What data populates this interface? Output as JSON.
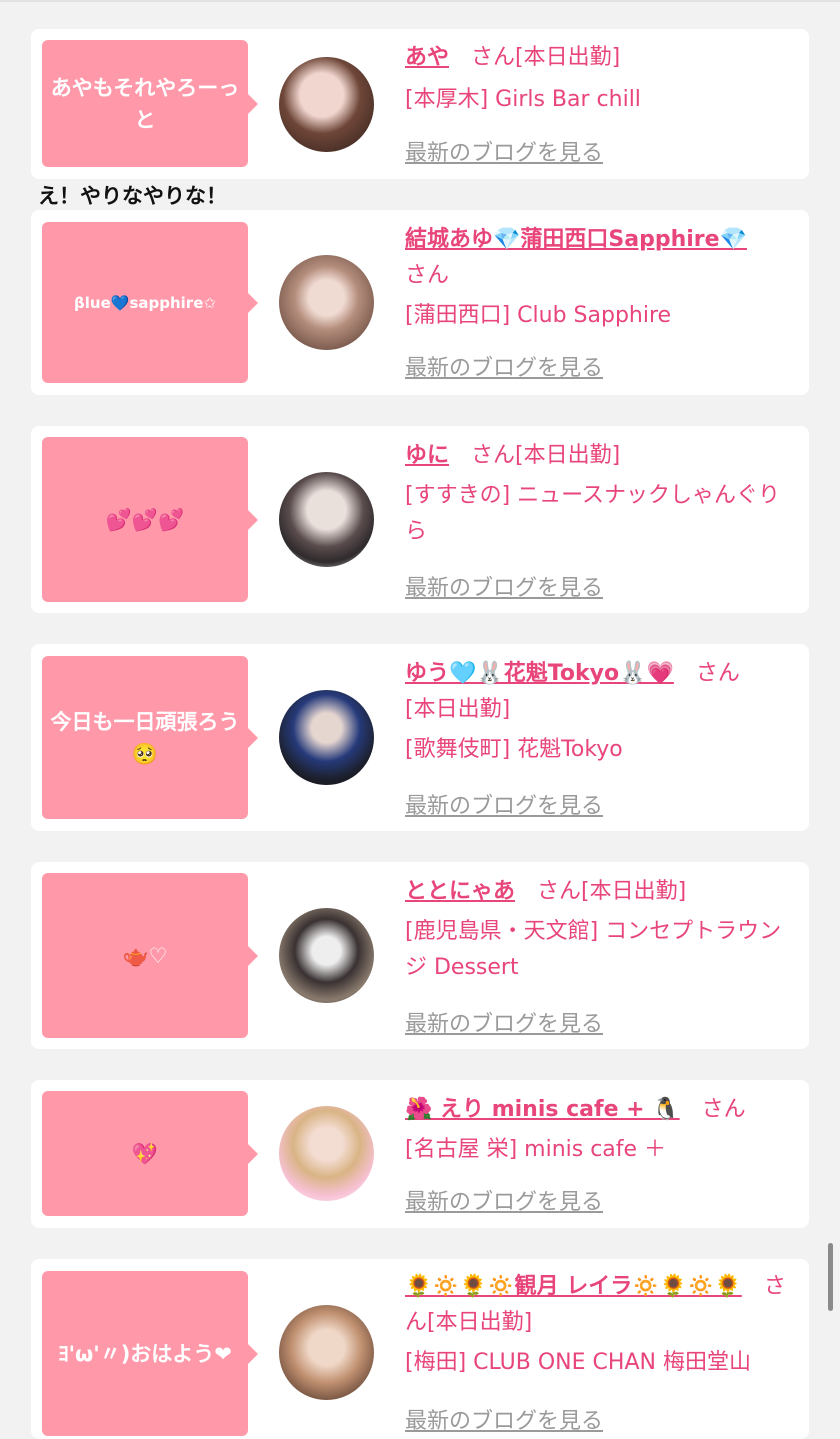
{
  "comment_between": "え！やりなやりな！",
  "cards": [
    {
      "bubble": "あやもそれやろーっと",
      "name": "あや",
      "san": "さん",
      "status": "[本日出勤]",
      "shop": "[本厚木] Girls Bar chill",
      "blog_link": "最新のブログを見る"
    },
    {
      "bubble": "βlue💙sapphire✩",
      "name": "結城あゆ💎蒲田西口Sapphire💎",
      "san": "さん",
      "status": "",
      "shop": "[蒲田西口] Club Sapphire",
      "blog_link": "最新のブログを見る"
    },
    {
      "bubble": "💕💕💕",
      "name": "ゆに",
      "san": "さん",
      "status": "[本日出勤]",
      "shop": "[すすきの] ニュースナックしゃんぐりら",
      "blog_link": "最新のブログを見る"
    },
    {
      "bubble": "今日も一日頑張ろう🥺",
      "name": "ゆう🩵🐰花魁Tokyo🐰💗",
      "san": "さん",
      "status": "[本日出勤]",
      "shop": "[歌舞伎町] 花魁Tokyo",
      "blog_link": "最新のブログを見る"
    },
    {
      "bubble": "🫖♡",
      "name": "ととにゃあ",
      "san": "さん",
      "status": "[本日出勤]",
      "shop": "[鹿児島県・天文館] コンセプトラウンジ Dessert",
      "blog_link": "最新のブログを見る"
    },
    {
      "bubble": "💖",
      "name": "🌺 えり minis cafe + 🐧",
      "san": "さん",
      "status": "",
      "shop": "[名古屋 栄] minis cafe ＋",
      "blog_link": "最新のブログを見る"
    },
    {
      "bubble": "ﾖ'ω'〃)おはよう❤",
      "name": "🌻🔅🌻🔅観月 レイラ🔅🌻🔅🌻",
      "san": "さん",
      "status": "[本日出勤]",
      "shop": "[梅田] CLUB ONE CHAN 梅田堂山",
      "blog_link": "最新のブログを見る"
    }
  ],
  "colors": {
    "accent": "#e8457a",
    "bubble": "#ff99aa",
    "link_gray": "#9a9a9a"
  }
}
